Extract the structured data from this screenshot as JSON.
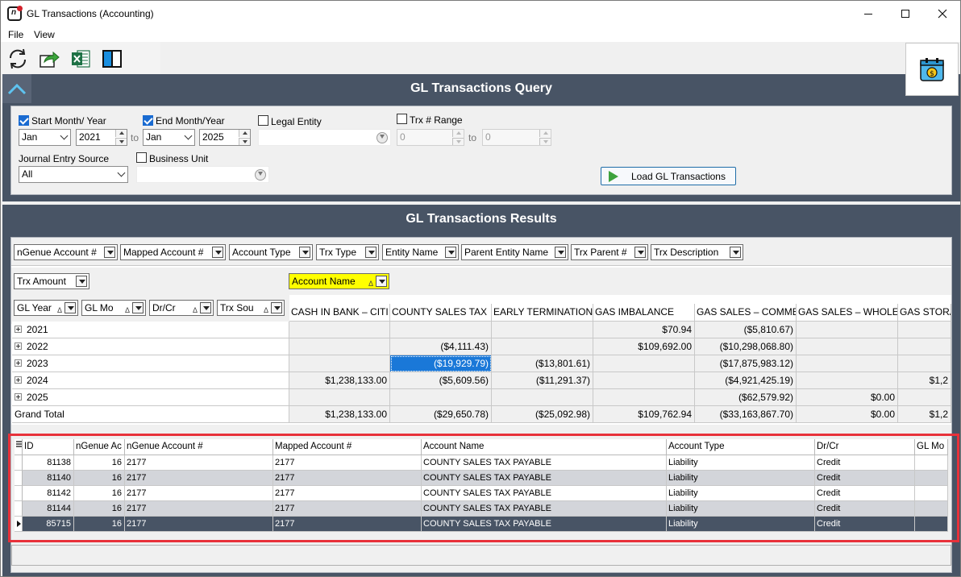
{
  "window": {
    "title": "GL Transactions (Accounting)"
  },
  "menu": {
    "file": "File",
    "view": "View"
  },
  "toolbar": {
    "icons": [
      "refresh-icon",
      "export-icon",
      "excel-icon",
      "layout-panel-icon",
      "calendar-money-icon"
    ]
  },
  "query": {
    "header": "GL Transactions Query",
    "start_label": "Start Month/ Year",
    "start_checked": true,
    "start_month": "Jan",
    "start_year": "2021",
    "to_label": "to",
    "end_label": "End Month/Year",
    "end_checked": true,
    "end_month": "Jan",
    "end_year": "2025",
    "legal_entity_label": "Legal Entity",
    "trx_range_label": "Trx # Range",
    "trx_from": "0",
    "trx_to": "0",
    "journal_label": "Journal Entry Source",
    "journal_value": "All",
    "business_unit_label": "Business Unit",
    "load_label": "Load GL Transactions"
  },
  "results": {
    "header": "GL Transactions Results",
    "filter_fields": [
      "nGenue Account #",
      "Mapped Account #",
      "Account Type",
      "Trx Type",
      "Entity Name",
      "Parent Entity Name",
      "Trx Parent #",
      "Trx Description"
    ],
    "data_field": "Trx Amount",
    "column_field": "Account Name",
    "column_field_sort": "Δ",
    "row_fields": [
      "GL Year",
      "GL Mo",
      "Dr/Cr",
      "Trx Sou"
    ],
    "row_field_sort": "Δ",
    "columns": [
      "CASH IN BANK – CITI…",
      "COUNTY SALES TAX …",
      "EARLY TERMINATION",
      "GAS IMBALANCE",
      "GAS SALES – COMME…",
      "GAS SALES – WHOLE…",
      "GAS STORAG"
    ],
    "rows": [
      {
        "label": "2021",
        "values": [
          "",
          "",
          "",
          "$70.94",
          "($5,810.67)",
          "",
          ""
        ]
      },
      {
        "label": "2022",
        "values": [
          "",
          "($4,111.43)",
          "",
          "$109,692.00",
          "($10,298,068.80)",
          "",
          ""
        ]
      },
      {
        "label": "2023",
        "values": [
          "",
          "($19,929.79)",
          "($13,801.61)",
          "",
          "($17,875,983.12)",
          "",
          ""
        ]
      },
      {
        "label": "2024",
        "values": [
          "$1,238,133.00",
          "($5,609.56)",
          "($11,291.37)",
          "",
          "($4,921,425.19)",
          "",
          "$1,2"
        ]
      },
      {
        "label": "2025",
        "values": [
          "",
          "",
          "",
          "",
          "($62,579.92)",
          "$0.00",
          ""
        ]
      }
    ],
    "grand_total": {
      "label": "Grand Total",
      "values": [
        "$1,238,133.00",
        "($29,650.78)",
        "($25,092.98)",
        "$109,762.94",
        "($33,163,867.70)",
        "$0.00",
        "$1,2"
      ]
    }
  },
  "detail": {
    "columns": [
      "ID",
      "nGenue Ac",
      "nGenue Account #",
      "Mapped Account #",
      "Account Name",
      "Account Type",
      "Dr/Cr",
      "GL Mo"
    ],
    "rows": [
      {
        "id": "81138",
        "ac": "16",
        "account": "2177",
        "mapped": "2177",
        "name": "COUNTY SALES TAX PAYABLE",
        "type": "Liability",
        "drcr": "Credit",
        "glmo": ""
      },
      {
        "id": "81140",
        "ac": "16",
        "account": "2177",
        "mapped": "2177",
        "name": "COUNTY SALES TAX PAYABLE",
        "type": "Liability",
        "drcr": "Credit",
        "glmo": ""
      },
      {
        "id": "81142",
        "ac": "16",
        "account": "2177",
        "mapped": "2177",
        "name": "COUNTY SALES TAX PAYABLE",
        "type": "Liability",
        "drcr": "Credit",
        "glmo": ""
      },
      {
        "id": "81144",
        "ac": "16",
        "account": "2177",
        "mapped": "2177",
        "name": "COUNTY SALES TAX PAYABLE",
        "type": "Liability",
        "drcr": "Credit",
        "glmo": ""
      },
      {
        "id": "85715",
        "ac": "16",
        "account": "2177",
        "mapped": "2177",
        "name": "COUNTY SALES TAX PAYABLE",
        "type": "Liability",
        "drcr": "Credit",
        "glmo": ""
      }
    ]
  },
  "colors": {
    "header_bg": "#485465",
    "selection": "#1a78d8",
    "highlight_field": "#ffff00",
    "annotation_frame": "#e8313a",
    "selected_row": "#485465"
  }
}
